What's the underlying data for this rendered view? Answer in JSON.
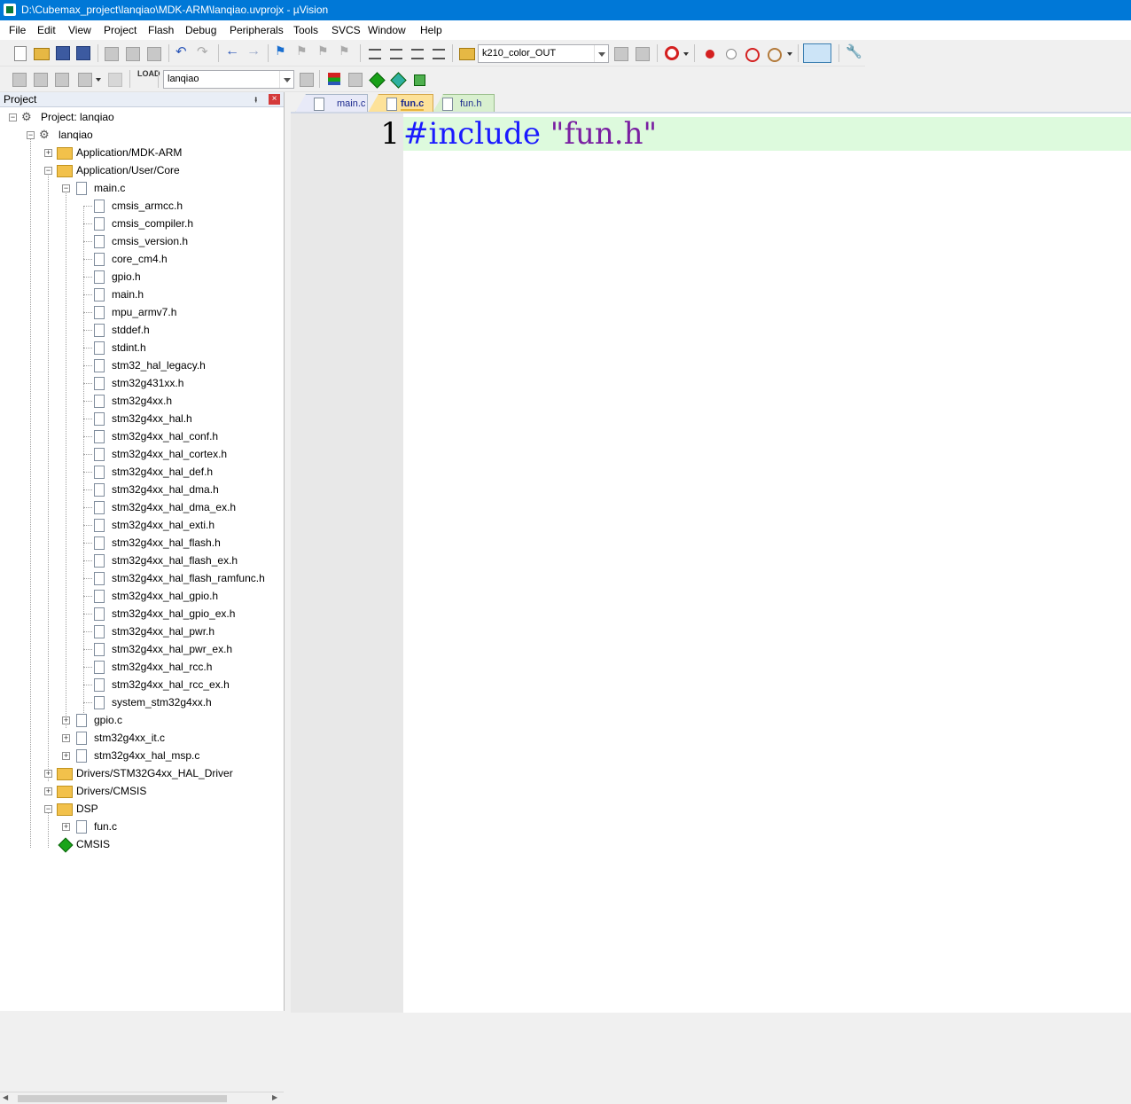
{
  "window": {
    "title": "D:\\Cubemax_project\\lanqiao\\MDK-ARM\\lanqiao.uvprojx - µVision"
  },
  "menu": [
    "File",
    "Edit",
    "View",
    "Project",
    "Flash",
    "Debug",
    "Peripherals",
    "Tools",
    "SVCS",
    "Window",
    "Help"
  ],
  "toolbar": {
    "find_combo_value": "k210_color_OUT",
    "target_combo_value": "lanqiao",
    "load_label": "LOAD"
  },
  "project_pane": {
    "title": "Project",
    "pin": "⭻",
    "close": "×",
    "tree": [
      {
        "label": "Project: lanqiao",
        "kind": "project",
        "exp": "-"
      },
      {
        "label": "lanqiao",
        "kind": "target",
        "exp": "-"
      },
      {
        "label": "Application/MDK-ARM",
        "kind": "folder",
        "exp": "+"
      },
      {
        "label": "Application/User/Core",
        "kind": "folder",
        "exp": "-"
      },
      {
        "label": "main.c",
        "kind": "file",
        "exp": "-"
      },
      {
        "label": "cmsis_armcc.h",
        "kind": "header"
      },
      {
        "label": "cmsis_compiler.h",
        "kind": "header"
      },
      {
        "label": "cmsis_version.h",
        "kind": "header"
      },
      {
        "label": "core_cm4.h",
        "kind": "header"
      },
      {
        "label": "gpio.h",
        "kind": "header"
      },
      {
        "label": "main.h",
        "kind": "header"
      },
      {
        "label": "mpu_armv7.h",
        "kind": "header"
      },
      {
        "label": "stddef.h",
        "kind": "header"
      },
      {
        "label": "stdint.h",
        "kind": "header"
      },
      {
        "label": "stm32_hal_legacy.h",
        "kind": "header"
      },
      {
        "label": "stm32g431xx.h",
        "kind": "header"
      },
      {
        "label": "stm32g4xx.h",
        "kind": "header"
      },
      {
        "label": "stm32g4xx_hal.h",
        "kind": "header"
      },
      {
        "label": "stm32g4xx_hal_conf.h",
        "kind": "header"
      },
      {
        "label": "stm32g4xx_hal_cortex.h",
        "kind": "header"
      },
      {
        "label": "stm32g4xx_hal_def.h",
        "kind": "header"
      },
      {
        "label": "stm32g4xx_hal_dma.h",
        "kind": "header"
      },
      {
        "label": "stm32g4xx_hal_dma_ex.h",
        "kind": "header"
      },
      {
        "label": "stm32g4xx_hal_exti.h",
        "kind": "header"
      },
      {
        "label": "stm32g4xx_hal_flash.h",
        "kind": "header"
      },
      {
        "label": "stm32g4xx_hal_flash_ex.h",
        "kind": "header"
      },
      {
        "label": "stm32g4xx_hal_flash_ramfunc.h",
        "kind": "header"
      },
      {
        "label": "stm32g4xx_hal_gpio.h",
        "kind": "header"
      },
      {
        "label": "stm32g4xx_hal_gpio_ex.h",
        "kind": "header"
      },
      {
        "label": "stm32g4xx_hal_pwr.h",
        "kind": "header"
      },
      {
        "label": "stm32g4xx_hal_pwr_ex.h",
        "kind": "header"
      },
      {
        "label": "stm32g4xx_hal_rcc.h",
        "kind": "header"
      },
      {
        "label": "stm32g4xx_hal_rcc_ex.h",
        "kind": "header"
      },
      {
        "label": "system_stm32g4xx.h",
        "kind": "header"
      },
      {
        "label": "gpio.c",
        "kind": "file",
        "exp": "+"
      },
      {
        "label": "stm32g4xx_it.c",
        "kind": "file",
        "exp": "+"
      },
      {
        "label": "stm32g4xx_hal_msp.c",
        "kind": "file",
        "exp": "+"
      },
      {
        "label": "Drivers/STM32G4xx_HAL_Driver",
        "kind": "folder",
        "exp": "+"
      },
      {
        "label": "Drivers/CMSIS",
        "kind": "folder",
        "exp": "+"
      },
      {
        "label": "DSP",
        "kind": "folder",
        "exp": "-"
      },
      {
        "label": "fun.c",
        "kind": "file",
        "exp": "+"
      },
      {
        "label": "CMSIS",
        "kind": "component"
      }
    ]
  },
  "editor": {
    "tabs": [
      {
        "label": "main.c",
        "state": "inactive"
      },
      {
        "label": "fun.c",
        "state": "active"
      },
      {
        "label": "fun.h",
        "state": "inactive-alt"
      }
    ],
    "line_number": "1",
    "code_keyword": "#include",
    "code_string": "\"fun.h\""
  },
  "colors": {
    "titlebar": "#0078d7",
    "keyword": "#1a1aff",
    "string": "#7a1fa2",
    "current_line": "#ddfadd",
    "active_tab": "#fde299"
  }
}
